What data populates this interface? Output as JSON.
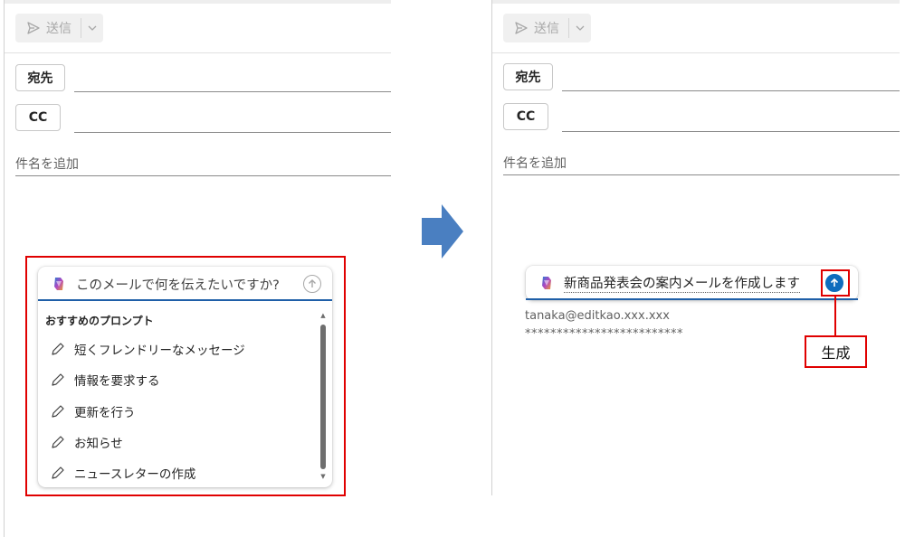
{
  "left_panel": {
    "send_label": "送信",
    "to_label": "宛先",
    "cc_label": "CC",
    "subject_placeholder": "件名を追加",
    "copilot": {
      "prompt_placeholder": "このメールで何を伝えたいですか?",
      "section_title": "おすすめのプロンプト",
      "suggestions": [
        "短くフレンドリーなメッセージ",
        "情報を要求する",
        "更新を行う",
        "お知らせ",
        "ニュースレターの作成"
      ]
    }
  },
  "right_panel": {
    "send_label": "送信",
    "to_label": "宛先",
    "cc_label": "CC",
    "subject_placeholder": "件名を追加",
    "copilot": {
      "prompt_text": "新商品発表会の案内メールを作成します",
      "response_email": "tanaka@editkao.xxx.xxx",
      "response_masked": "*************************"
    },
    "callout_label": "生成"
  },
  "colors": {
    "highlight_red": "#e00000",
    "flow_arrow": "#4a7fc1",
    "copilot_accent": "#0f6cbd"
  },
  "icons": {
    "send": "send-icon",
    "dropdown": "chevron-down-icon",
    "copilot": "copilot-logo-icon",
    "submit": "arrow-up-circle-icon",
    "suggestion": "pencil-icon"
  }
}
